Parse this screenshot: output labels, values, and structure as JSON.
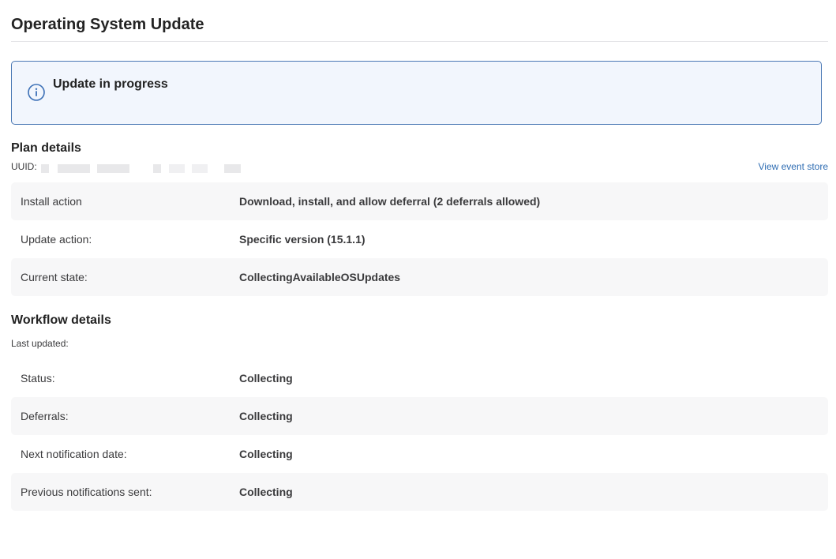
{
  "page": {
    "title": "Operating System Update"
  },
  "banner": {
    "icon": "info-icon",
    "text": "Update in progress",
    "accent_color": "#4a78b4",
    "background_color": "#f2f6fd"
  },
  "plan_details": {
    "heading": "Plan details",
    "uuid_label": "UUID:",
    "uuid_value_redacted": true,
    "view_event_store_link": "View event store",
    "rows": [
      {
        "label": "Install action",
        "value": "Download, install, and allow deferral (2 deferrals allowed)"
      },
      {
        "label": "Update action:",
        "value": "Specific version (15.1.1)"
      },
      {
        "label": "Current state:",
        "value": "CollectingAvailableOSUpdates"
      }
    ]
  },
  "workflow_details": {
    "heading": "Workflow details",
    "last_updated_label": "Last updated:",
    "rows": [
      {
        "label": "Status:",
        "value": "Collecting"
      },
      {
        "label": "Deferrals:",
        "value": "Collecting"
      },
      {
        "label": "Next notification date:",
        "value": "Collecting"
      },
      {
        "label": "Previous notifications sent:",
        "value": "Collecting"
      }
    ]
  },
  "colors": {
    "link": "#2f6db3",
    "shaded_row": "#f7f7f8"
  }
}
